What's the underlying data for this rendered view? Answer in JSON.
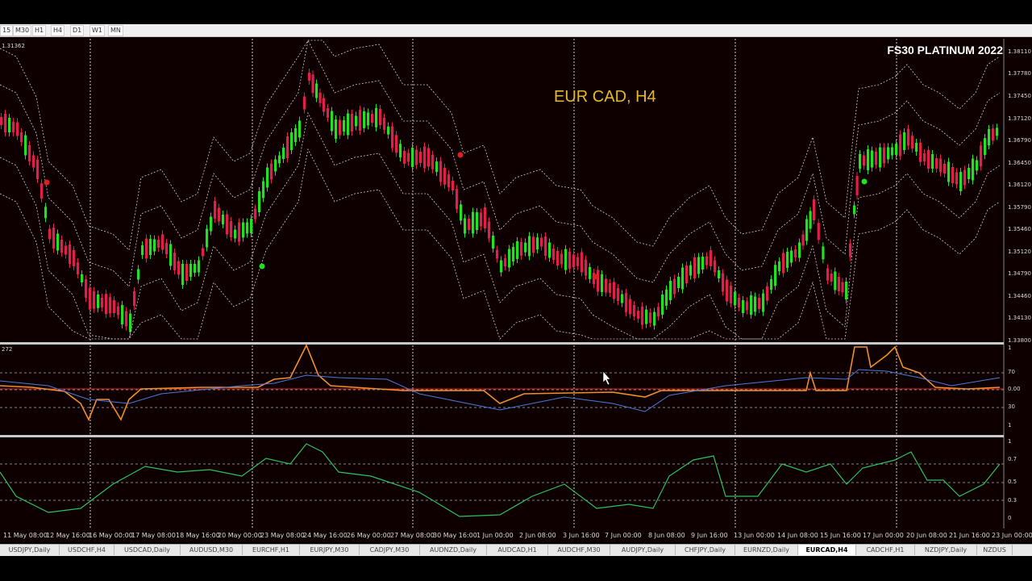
{
  "timeframes": [
    "15",
    "M30",
    "H1",
    "H4",
    "D1",
    "W1",
    "MN"
  ],
  "brand": "FS30 PLATINUM 2022",
  "symbol_title": "EUR CAD, H4",
  "price_top_label": "1.31362",
  "indicator_top_label": "272",
  "price_scale": [
    "1.38110",
    "1.37780",
    "1.37450",
    "1.37120",
    "1.36790",
    "1.36450",
    "1.36120",
    "1.35790",
    "1.35460",
    "1.35120",
    "1.34790",
    "1.34460",
    "1.34130",
    "1.33800"
  ],
  "ind1_scale": [
    "1",
    "70",
    "0.00",
    "30",
    "1"
  ],
  "ind2_scale": [
    "1",
    "0.7",
    "0.5",
    "0.3",
    "0"
  ],
  "time_labels": [
    "11 May 08:00",
    "12 May 16:00",
    "16 May 00:00",
    "17 May 08:00",
    "18 May 16:00",
    "20 May 00:00",
    "23 May 08:00",
    "24 May 16:00",
    "26 May 00:00",
    "27 May 08:00",
    "30 May 16:00",
    "1 Jun 00:00",
    "2 Jun 08:00",
    "3 Jun 16:00",
    "7 Jun 00:00",
    "8 Jun 08:00",
    "9 Jun 16:00",
    "13 Jun 00:00",
    "14 Jun 08:00",
    "15 Jun 16:00",
    "17 Jun 00:00",
    "20 Jun 08:00",
    "21 Jun 16:00",
    "23 Jun 00:00"
  ],
  "symbol_tabs": [
    "USDJPY,Daily",
    "USDCHF,H4",
    "USDCAD,Daily",
    "AUDUSD,M30",
    "EURCHF,H1",
    "EURJPY,M30",
    "CADJPY,M30",
    "AUDNZD,Daily",
    "AUDCAD,H1",
    "AUDCHF,M30",
    "AUDJPY,Daily",
    "CHFJPY,Daily",
    "EURNZD,Daily",
    "EURCAD,H4",
    "CADCHF,H1",
    "NZDJPY,Daily",
    "NZDUS"
  ],
  "active_tab": "EURCAD,H4",
  "colors": {
    "background": "#0e0000",
    "bull_candle": "#22e022",
    "bear_candle": "#e0204a",
    "title": "#e6b82e",
    "line_orange": "#f0902a",
    "line_blue": "#4a7adc",
    "line_green": "#2ec25a"
  },
  "icons": [
    "mouse-cursor-icon"
  ]
}
